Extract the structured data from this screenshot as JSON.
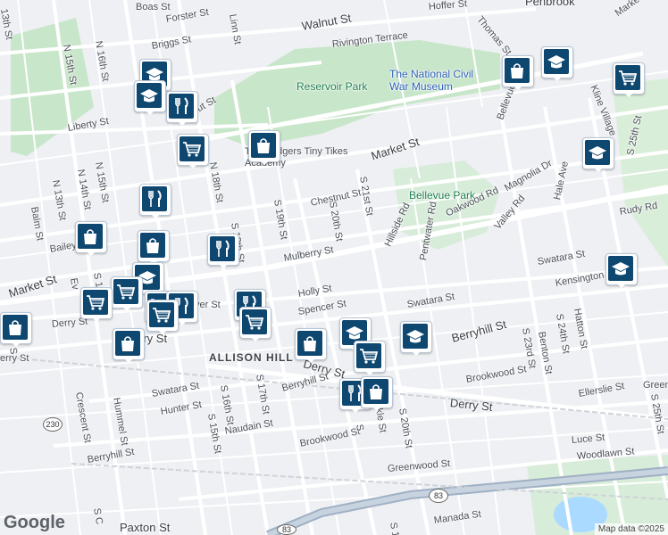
{
  "map": {
    "labels": {
      "boas": "Boas St",
      "forster": "Forster St",
      "briggs": "Briggs St",
      "n16": "N 16th St",
      "n15a": "N 15th St",
      "th13": "13th St",
      "linn": "Linn St",
      "walnut": "Walnut St",
      "rivington": "Rivington Terrace",
      "hoffer": "Hoffer St",
      "thomas": "Thomas St",
      "penbrook": "Penbrook",
      "market_tr": "Market St",
      "reservoir": "Reservoir Park",
      "museum": "The National Civil War Museum",
      "kline": "Kline Village",
      "liberty": "Liberty St",
      "nut": "nut St",
      "n13": "N 13th St",
      "n14": "N 14th St",
      "n15b": "N 15th St",
      "n18": "N 18th St",
      "s19": "S 19th St",
      "s20": "S 20th St",
      "s21": "S 21st St",
      "market_mid": "Market St",
      "tiny_tikes": "The Rodgers Tiny Tikes Academy",
      "chestnut": "Chestnut St",
      "bellevue_park": "Bellevue Park",
      "bellevue_rd": "Bellevue Rd",
      "hale": "Hale Ave",
      "s25a": "S 25th St",
      "magnolia": "Magnolia Dr",
      "oakwood": "Oakwood Rd",
      "valley": "Valley Rd",
      "rudy": "Rudy Rd",
      "hillside": "Hillside Rd",
      "pentwater": "Pentwater Rd",
      "balm": "Balm St",
      "bailey": "Bailey St",
      "market_left": "Market St",
      "s18": "S 18th St",
      "mulberry": "Mulberry St",
      "swatara_r": "Swatara St",
      "kensington": "Kensington St",
      "holly": "Holly St",
      "spencer": "Spencer St",
      "swatara_m": "Swatara St",
      "berryhill_r": "Berryhill St",
      "s23": "S 23rd St",
      "s24": "S 24th St",
      "hatton": "Hatton St",
      "benton": "Benton St",
      "derry_left": "Derry St",
      "derry_l2": "rry St",
      "allison": "ALLISON HILL",
      "derry_mid": "Derry St",
      "s16": "S 16th St",
      "s17": "S 17th St",
      "swatara_l": "Swatara St",
      "hunter": "Hunter St",
      "s15": "S 15th St",
      "crescent": "Crescent St",
      "hummel": "Hummel St",
      "berryhill_m": "Berryhill St",
      "naudain": "Naudain St",
      "brookwood_r": "Brookwood St",
      "ellerslie": "Ellerslie St",
      "green": "Green",
      "s25b": "S 25th St",
      "derry_r": "Derry St",
      "s20b": "S 20th St",
      "luce": "Luce St",
      "woodlawn": "Woodlawn St",
      "brookwood_l": "Brookwood St",
      "greenwood": "Greenwood St",
      "berryhill_l": "Berryhill St",
      "paxton": "Paxton St",
      "manada": "Manada St",
      "cs": "S C",
      "kle": "kle St",
      "st_frag": "S",
      "erry": "erry St",
      "s_fr": "S 1",
      "s_t": "S 1",
      "ver": "ver St",
      "ev": "Ev",
      "s12": "S 12",
      "s_nin": "S"
    },
    "shields": {
      "i83a": "83",
      "i83b": "83",
      "r230": "230"
    },
    "markers": [
      {
        "icon": "school",
        "name": "school-marker"
      },
      {
        "icon": "restaurant",
        "name": "restaurant-marker"
      },
      {
        "icon": "school",
        "name": "school-marker"
      },
      {
        "icon": "grocery",
        "name": "grocery-marker"
      },
      {
        "icon": "shopping",
        "name": "shopping-marker"
      },
      {
        "icon": "shopping",
        "name": "shopping-marker"
      },
      {
        "icon": "school",
        "name": "school-marker"
      },
      {
        "icon": "grocery",
        "name": "grocery-marker"
      },
      {
        "icon": "school",
        "name": "school-marker"
      },
      {
        "icon": "restaurant",
        "name": "restaurant-marker"
      },
      {
        "icon": "shopping",
        "name": "shopping-marker"
      },
      {
        "icon": "shopping",
        "name": "shopping-marker"
      },
      {
        "icon": "restaurant",
        "name": "restaurant-marker"
      },
      {
        "icon": "school",
        "name": "school-marker"
      },
      {
        "icon": "grocery",
        "name": "grocery-marker"
      },
      {
        "icon": "grocery",
        "name": "grocery-marker"
      },
      {
        "icon": "grocery",
        "name": "grocery-marker"
      },
      {
        "icon": "restaurant",
        "name": "restaurant-marker"
      },
      {
        "icon": "grocery",
        "name": "grocery-marker"
      },
      {
        "icon": "shopping",
        "name": "shopping-marker"
      },
      {
        "icon": "restaurant",
        "name": "restaurant-marker"
      },
      {
        "icon": "grocery",
        "name": "grocery-marker"
      },
      {
        "icon": "shopping",
        "name": "shopping-marker"
      },
      {
        "icon": "school",
        "name": "school-marker"
      },
      {
        "icon": "school",
        "name": "school-marker"
      },
      {
        "icon": "grocery",
        "name": "grocery-marker"
      },
      {
        "icon": "restaurant",
        "name": "restaurant-marker"
      },
      {
        "icon": "shopping",
        "name": "shopping-marker"
      },
      {
        "icon": "school",
        "name": "school-marker"
      },
      {
        "icon": "shopping",
        "name": "shopping-marker"
      }
    ],
    "attribution": "Map data ©2025",
    "brand": "Google",
    "colors": {
      "marker": "#0e4770",
      "park": "#c8e6c9",
      "water": "#aadaff",
      "road": "#ffffff",
      "land": "#eef0f3"
    }
  }
}
